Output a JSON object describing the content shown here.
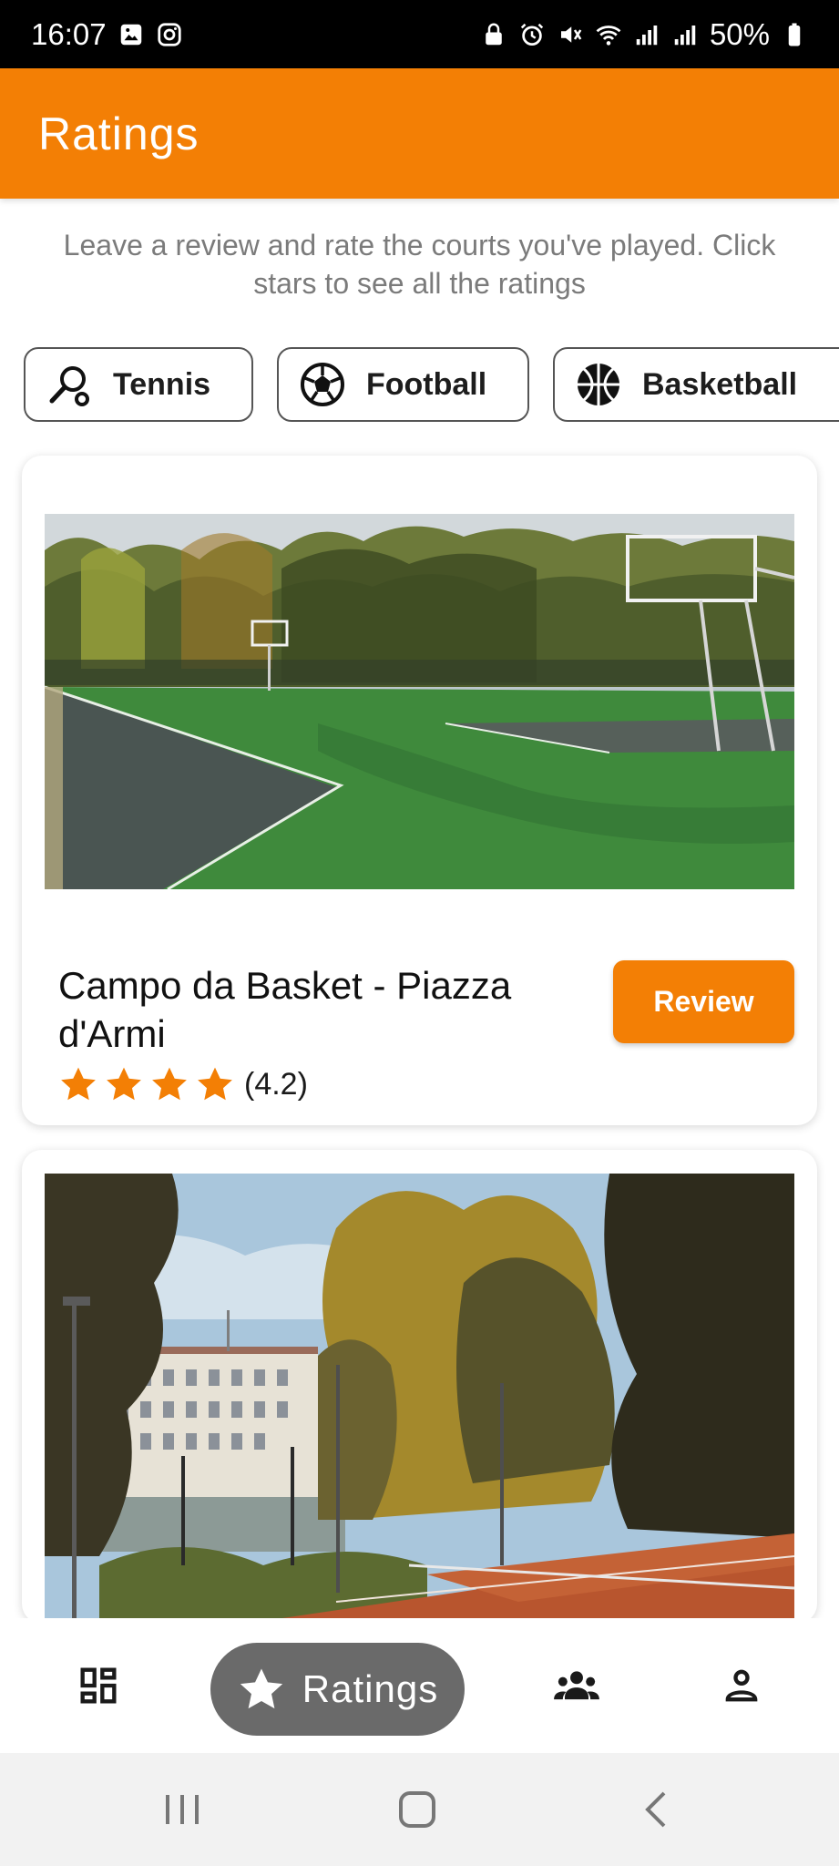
{
  "status_bar": {
    "time": "16:07",
    "battery": "50%",
    "icons": [
      "gallery-notification-icon",
      "instagram-icon",
      "lock-icon",
      "alarm-icon",
      "mute-icon",
      "wifi-icon",
      "signal-icon",
      "signal-icon-2",
      "battery-icon"
    ]
  },
  "app_bar": {
    "title": "Ratings"
  },
  "intro": {
    "text": "Leave a review and rate the courts you've played. Click stars to see all the ratings"
  },
  "filters": [
    {
      "label": "Tennis",
      "icon": "tennis-racket-icon"
    },
    {
      "label": "Football",
      "icon": "football-icon"
    },
    {
      "label": "Basketball",
      "icon": "basketball-icon"
    }
  ],
  "courts": [
    {
      "name": "Campo da Basket - Piazza d'Armi",
      "rating": "(4.2)",
      "stars": 4,
      "review_label": "Review",
      "image": "basketball-court-photo"
    },
    {
      "image": "tennis-court-photo"
    }
  ],
  "bottom_nav": {
    "items": [
      {
        "icon": "dashboard-icon"
      },
      {
        "icon": "star-icon",
        "label": "Ratings",
        "active": true
      },
      {
        "icon": "community-icon"
      },
      {
        "icon": "profile-icon"
      }
    ]
  },
  "colors": {
    "accent": "#f37f05",
    "nav_active": "#6a6a6a"
  }
}
